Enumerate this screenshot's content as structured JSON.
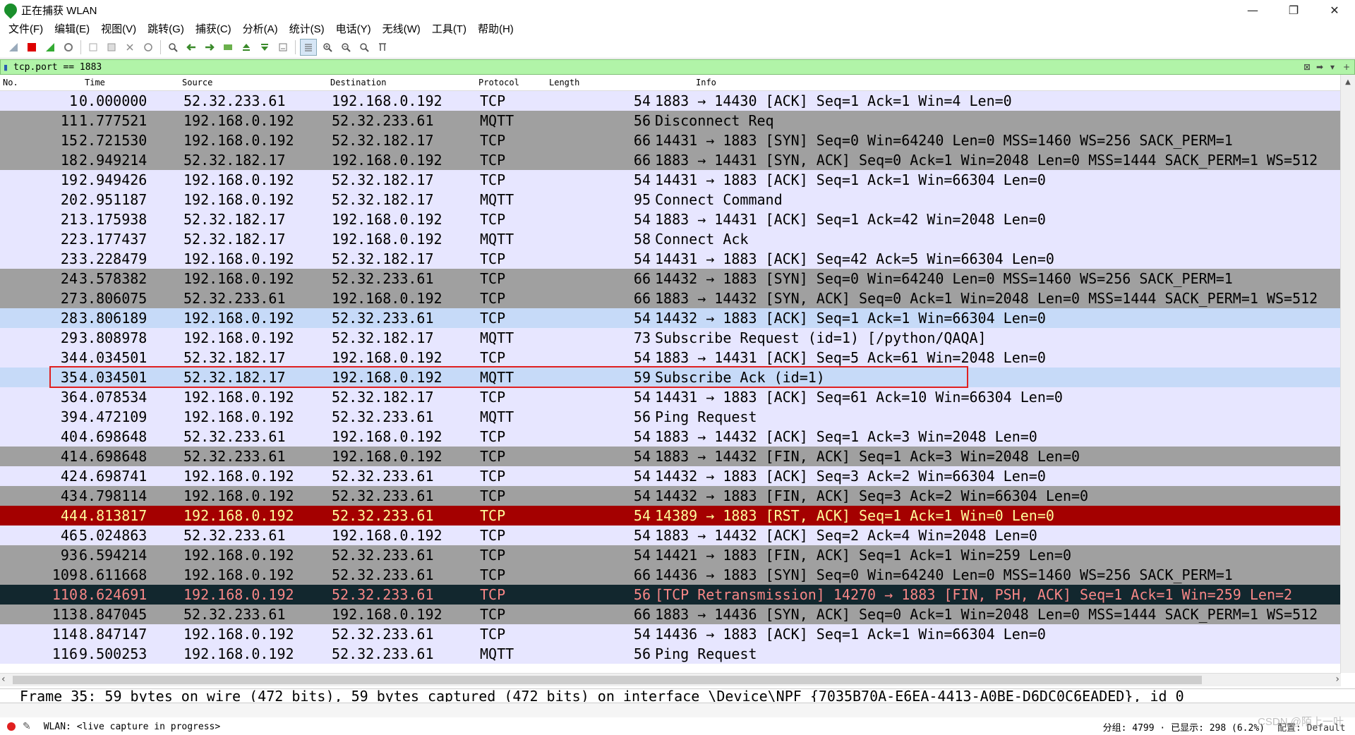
{
  "window": {
    "title": "正在捕获 WLAN",
    "minimize": "—",
    "maximize": "❐",
    "close": "✕"
  },
  "menu": [
    "文件(F)",
    "编辑(E)",
    "视图(V)",
    "跳转(G)",
    "捕获(C)",
    "分析(A)",
    "统计(S)",
    "电话(Y)",
    "无线(W)",
    "工具(T)",
    "帮助(H)"
  ],
  "filter": {
    "value": "tcp.port == 1883",
    "clear_icon": "clear-icon",
    "apply_icon": "apply-arrow-icon"
  },
  "columns": [
    "No.",
    "Time",
    "Source",
    "Destination",
    "Protocol",
    "Length",
    "Info"
  ],
  "packets": [
    {
      "no": "1",
      "time": "0.000000",
      "src": "52.32.233.61",
      "dst": "192.168.0.192",
      "proto": "TCP",
      "len": "54",
      "info": "1883 → 14430 [ACK] Seq=1 Ack=1 Win=4 Len=0",
      "style": "lav"
    },
    {
      "no": "11",
      "time": "1.777521",
      "src": "192.168.0.192",
      "dst": "52.32.233.61",
      "proto": "MQTT",
      "len": "56",
      "info": "Disconnect Req",
      "style": "gray"
    },
    {
      "no": "15",
      "time": "2.721530",
      "src": "192.168.0.192",
      "dst": "52.32.182.17",
      "proto": "TCP",
      "len": "66",
      "info": "14431 → 1883 [SYN] Seq=0 Win=64240 Len=0 MSS=1460 WS=256 SACK_PERM=1",
      "style": "gray"
    },
    {
      "no": "18",
      "time": "2.949214",
      "src": "52.32.182.17",
      "dst": "192.168.0.192",
      "proto": "TCP",
      "len": "66",
      "info": "1883 → 14431 [SYN, ACK] Seq=0 Ack=1 Win=2048 Len=0 MSS=1444 SACK_PERM=1 WS=512",
      "style": "gray"
    },
    {
      "no": "19",
      "time": "2.949426",
      "src": "192.168.0.192",
      "dst": "52.32.182.17",
      "proto": "TCP",
      "len": "54",
      "info": "14431 → 1883 [ACK] Seq=1 Ack=1 Win=66304 Len=0",
      "style": "lav"
    },
    {
      "no": "20",
      "time": "2.951187",
      "src": "192.168.0.192",
      "dst": "52.32.182.17",
      "proto": "MQTT",
      "len": "95",
      "info": "Connect Command",
      "style": "lav"
    },
    {
      "no": "21",
      "time": "3.175938",
      "src": "52.32.182.17",
      "dst": "192.168.0.192",
      "proto": "TCP",
      "len": "54",
      "info": "1883 → 14431 [ACK] Seq=1 Ack=42 Win=2048 Len=0",
      "style": "lav"
    },
    {
      "no": "22",
      "time": "3.177437",
      "src": "52.32.182.17",
      "dst": "192.168.0.192",
      "proto": "MQTT",
      "len": "58",
      "info": "Connect Ack",
      "style": "lav"
    },
    {
      "no": "23",
      "time": "3.228479",
      "src": "192.168.0.192",
      "dst": "52.32.182.17",
      "proto": "TCP",
      "len": "54",
      "info": "14431 → 1883 [ACK] Seq=42 Ack=5 Win=66304 Len=0",
      "style": "lav"
    },
    {
      "no": "24",
      "time": "3.578382",
      "src": "192.168.0.192",
      "dst": "52.32.233.61",
      "proto": "TCP",
      "len": "66",
      "info": "14432 → 1883 [SYN] Seq=0 Win=64240 Len=0 MSS=1460 WS=256 SACK_PERM=1",
      "style": "gray"
    },
    {
      "no": "27",
      "time": "3.806075",
      "src": "52.32.233.61",
      "dst": "192.168.0.192",
      "proto": "TCP",
      "len": "66",
      "info": "1883 → 14432 [SYN, ACK] Seq=0 Ack=1 Win=2048 Len=0 MSS=1444 SACK_PERM=1 WS=512",
      "style": "gray"
    },
    {
      "no": "28",
      "time": "3.806189",
      "src": "192.168.0.192",
      "dst": "52.32.233.61",
      "proto": "TCP",
      "len": "54",
      "info": "14432 → 1883 [ACK] Seq=1 Ack=1 Win=66304 Len=0",
      "style": "blue"
    },
    {
      "no": "29",
      "time": "3.808978",
      "src": "192.168.0.192",
      "dst": "52.32.182.17",
      "proto": "MQTT",
      "len": "73",
      "info": "Subscribe Request (id=1) [/python/QAQA]",
      "style": "lav"
    },
    {
      "no": "34",
      "time": "4.034501",
      "src": "52.32.182.17",
      "dst": "192.168.0.192",
      "proto": "TCP",
      "len": "54",
      "info": "1883 → 14431 [ACK] Seq=5 Ack=61 Win=2048 Len=0",
      "style": "lav"
    },
    {
      "no": "35",
      "time": "4.034501",
      "src": "52.32.182.17",
      "dst": "192.168.0.192",
      "proto": "MQTT",
      "len": "59",
      "info": "Subscribe Ack (id=1)",
      "style": "blue"
    },
    {
      "no": "36",
      "time": "4.078534",
      "src": "192.168.0.192",
      "dst": "52.32.182.17",
      "proto": "TCP",
      "len": "54",
      "info": "14431 → 1883 [ACK] Seq=61 Ack=10 Win=66304 Len=0",
      "style": "lav"
    },
    {
      "no": "39",
      "time": "4.472109",
      "src": "192.168.0.192",
      "dst": "52.32.233.61",
      "proto": "MQTT",
      "len": "56",
      "info": "Ping Request",
      "style": "lav"
    },
    {
      "no": "40",
      "time": "4.698648",
      "src": "52.32.233.61",
      "dst": "192.168.0.192",
      "proto": "TCP",
      "len": "54",
      "info": "1883 → 14432 [ACK] Seq=1 Ack=3 Win=2048 Len=0",
      "style": "lav"
    },
    {
      "no": "41",
      "time": "4.698648",
      "src": "52.32.233.61",
      "dst": "192.168.0.192",
      "proto": "TCP",
      "len": "54",
      "info": "1883 → 14432 [FIN, ACK] Seq=1 Ack=3 Win=2048 Len=0",
      "style": "gray"
    },
    {
      "no": "42",
      "time": "4.698741",
      "src": "192.168.0.192",
      "dst": "52.32.233.61",
      "proto": "TCP",
      "len": "54",
      "info": "14432 → 1883 [ACK] Seq=3 Ack=2 Win=66304 Len=0",
      "style": "lav"
    },
    {
      "no": "43",
      "time": "4.798114",
      "src": "192.168.0.192",
      "dst": "52.32.233.61",
      "proto": "TCP",
      "len": "54",
      "info": "14432 → 1883 [FIN, ACK] Seq=3 Ack=2 Win=66304 Len=0",
      "style": "gray"
    },
    {
      "no": "44",
      "time": "4.813817",
      "src": "192.168.0.192",
      "dst": "52.32.233.61",
      "proto": "TCP",
      "len": "54",
      "info": "14389 → 1883 [RST, ACK] Seq=1 Ack=1 Win=0 Len=0",
      "style": "red"
    },
    {
      "no": "46",
      "time": "5.024863",
      "src": "52.32.233.61",
      "dst": "192.168.0.192",
      "proto": "TCP",
      "len": "54",
      "info": "1883 → 14432 [ACK] Seq=2 Ack=4 Win=2048 Len=0",
      "style": "lav"
    },
    {
      "no": "93",
      "time": "6.594214",
      "src": "192.168.0.192",
      "dst": "52.32.233.61",
      "proto": "TCP",
      "len": "54",
      "info": "14421 → 1883 [FIN, ACK] Seq=1 Ack=1 Win=259 Len=0",
      "style": "gray"
    },
    {
      "no": "109",
      "time": "8.611668",
      "src": "192.168.0.192",
      "dst": "52.32.233.61",
      "proto": "TCP",
      "len": "66",
      "info": "14436 → 1883 [SYN] Seq=0 Win=64240 Len=0 MSS=1460 WS=256 SACK_PERM=1",
      "style": "gray"
    },
    {
      "no": "110",
      "time": "8.624691",
      "src": "192.168.0.192",
      "dst": "52.32.233.61",
      "proto": "TCP",
      "len": "56",
      "info": "[TCP Retransmission] 14270 → 1883 [FIN, PSH, ACK] Seq=1 Ack=1 Win=259 Len=2",
      "style": "dark"
    },
    {
      "no": "113",
      "time": "8.847045",
      "src": "52.32.233.61",
      "dst": "192.168.0.192",
      "proto": "TCP",
      "len": "66",
      "info": "1883 → 14436 [SYN, ACK] Seq=0 Ack=1 Win=2048 Len=0 MSS=1444 SACK_PERM=1 WS=512",
      "style": "gray"
    },
    {
      "no": "114",
      "time": "8.847147",
      "src": "192.168.0.192",
      "dst": "52.32.233.61",
      "proto": "TCP",
      "len": "54",
      "info": "14436 → 1883 [ACK] Seq=1 Ack=1 Win=66304 Len=0",
      "style": "lav"
    },
    {
      "no": "116",
      "time": "9.500253",
      "src": "192.168.0.192",
      "dst": "52.32.233.61",
      "proto": "MQTT",
      "len": "56",
      "info": "Ping Request",
      "style": "lav"
    }
  ],
  "detail": {
    "line": "Frame 35: 59 bytes on wire (472 bits), 59 bytes captured (472 bits) on interface \\Device\\NPF_{7035B70A-E6EA-4413-A0BE-D6DC0C6EADED}, id 0"
  },
  "status": {
    "capture": "WLAN: <live capture in progress>",
    "stats": "分组: 4799 · 已显示: 298 (6.2%)",
    "profile": "配置: Default"
  },
  "watermark": "CSDN @陌上一叶"
}
